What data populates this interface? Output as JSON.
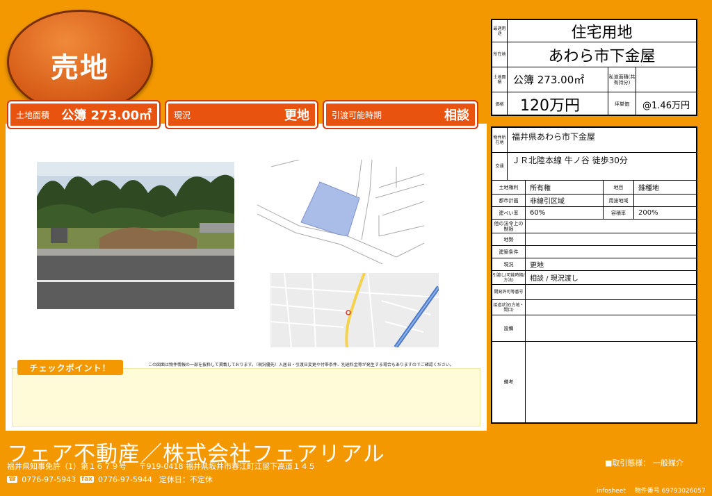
{
  "header": {
    "sale_type": "売地"
  },
  "badges": [
    {
      "key": "土地面積",
      "value": "公簿 273.00㎡"
    },
    {
      "key": "現況",
      "value": "更地"
    },
    {
      "key": "引渡可能時期",
      "value": "相談"
    }
  ],
  "summary": {
    "use_label": "最適用途",
    "use": "住宅用地",
    "location_label": "所在地",
    "location": "あわら市下金屋",
    "land_area_label": "土地面積",
    "land_area": "公簿 273.00㎡",
    "private_road_label": "私道面積(共有持分)",
    "private_road": "",
    "price_label": "価格",
    "price": "120万円",
    "unit_price_label": "坪単価",
    "unit_price": "@1.46万円"
  },
  "details": {
    "address_label": "物件所在地",
    "address": "福井県あわら市下金屋",
    "traffic_label": "交通",
    "traffic": "ＪＲ北陸本線 牛ノ谷 徒歩30分",
    "rights_label": "土地権利",
    "rights": "所有権",
    "chimoku_label": "地目",
    "chimoku": "雑種地",
    "city_plan_label": "都市計画",
    "city_plan": "非線引区域",
    "zoning_label": "用途地域",
    "zoning": "",
    "bcr_label": "建ぺい率",
    "bcr": "60%",
    "far_label": "容積率",
    "far": "200%",
    "other_limits_label": "他の法令上の制限",
    "other_limits": "",
    "terrain_label": "地勢",
    "terrain": "",
    "build_cond_label": "建築条件",
    "build_cond": "",
    "status_label": "現況",
    "status": "更地",
    "handover_label": "引渡し(可能時期/方法)",
    "handover": "相談 / 現況渡し",
    "permit_label": "開発許可等番号",
    "permit": "",
    "road_label": "接道状況(方地・間口)",
    "road": "",
    "facility_label": "設備",
    "facility": "",
    "remarks_label": "備考",
    "remarks": ""
  },
  "checkpoint": {
    "label": "チェックポイント！",
    "disclaimer": "この図面は物件情報の一部を抜粋して掲載しております。（現況優先）入居日・引渡日変更や付帯条件、別途料金等が発生する場合もありますのでご確認ください。"
  },
  "footer": {
    "company": "フェア不動産／株式会社フェアリアル",
    "license": "福井県知事免許（1）第１６７９号",
    "address": "〒919-0418 福井県坂井市春江町江留下高道１４５",
    "tel_icon": "☎",
    "tel": "0776-97-5943",
    "fax_icon": "fax",
    "fax": "0776-97-5944",
    "holiday": "定休日：不定休",
    "trade_type": "■取引態様：  一般媒介",
    "infosheet": "infosheet",
    "property_no": "物件番号  69793026057"
  },
  "colors": {
    "brand_orange": "#f39800",
    "badge_red": "#e8540f",
    "parcel_blue": "#a9bde8"
  }
}
